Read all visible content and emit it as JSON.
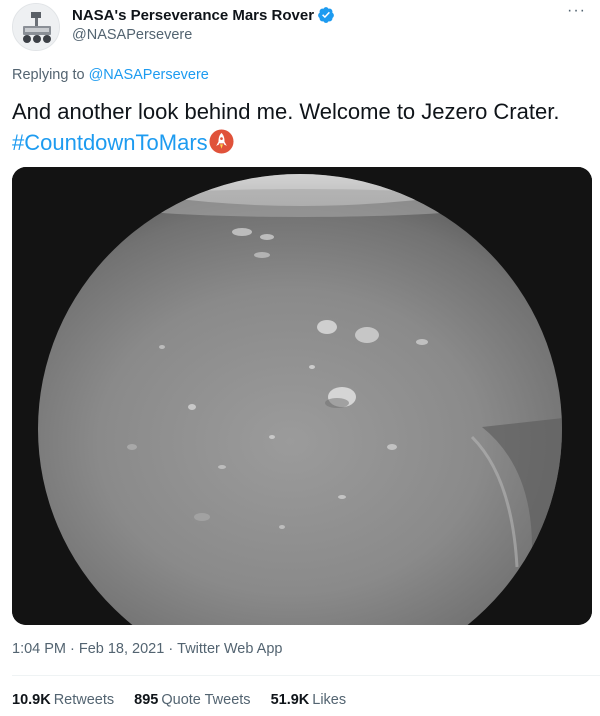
{
  "author": {
    "display_name": "NASA's Perseverance Mars Rover",
    "handle": "@NASAPersevere",
    "verified": true,
    "verified_color": "#1d9bf0"
  },
  "menu_icon": "more-horizontal-icon",
  "more_glyph": "···",
  "reply_context": {
    "prefix": "Replying to",
    "mention": "@NASAPersevere"
  },
  "tweet": {
    "text": "And another look behind me. Welcome to Jezero Crater.",
    "hashtag": "#CountdownToMars",
    "hashflag_icon": "rocket-hashflag-icon"
  },
  "media": {
    "type": "photo",
    "icon": "mars-surface-photo"
  },
  "meta": {
    "time": "1:04 PM",
    "date": "Feb 18, 2021",
    "source": "Twitter Web App",
    "separator": "·"
  },
  "stats": {
    "retweets": {
      "count": "10.9K",
      "label": "Retweets"
    },
    "quote_tweets": {
      "count": "895",
      "label": "Quote Tweets"
    },
    "likes": {
      "count": "51.9K",
      "label": "Likes"
    }
  },
  "colors": {
    "link": "#1d9bf0",
    "secondary_text": "#536471",
    "primary_text": "#0f1419",
    "hashflag": "#e0523a"
  }
}
